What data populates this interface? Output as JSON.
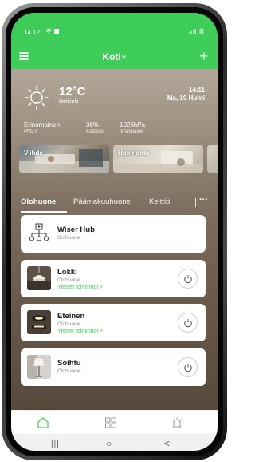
{
  "status_bar": {
    "time": "14.12",
    "left_icons": "᭻ ■",
    "right_icons": "⧂.❙l ▮"
  },
  "header": {
    "title": "Koti",
    "title_chevron": "˅",
    "add_label": "+"
  },
  "weather": {
    "temperature": "12°C",
    "city": "Helsinki",
    "time": "14:11",
    "date": "Ma, 19 Huhti",
    "metrics": [
      {
        "value": "Erinomainen",
        "label": "PM2.5"
      },
      {
        "value": "38%",
        "label": "Kosteus"
      },
      {
        "value": "1026hPa",
        "label": "Ilmanpaine"
      }
    ]
  },
  "scenes": [
    {
      "label": "Viihde"
    },
    {
      "label": "Huomenta"
    }
  ],
  "rooms": {
    "tabs": [
      "Olohuone",
      "Päämakuuhuone",
      "Keittiö"
    ],
    "active": "Olohuone",
    "more_label": "···"
  },
  "devices": [
    {
      "name": "Wiser Hub",
      "room": "Olohuone",
      "actions": "",
      "icon": "hub-icon"
    },
    {
      "name": "Lokki",
      "room": "Olohuone",
      "actions": "Yleiset toiminnot ˅",
      "icon": "pendant-lamp"
    },
    {
      "name": "Eteinen",
      "room": "Olohuone",
      "actions": "Yleiset toiminnot ˅",
      "icon": "ceiling-light"
    },
    {
      "name": "Soihtu",
      "room": "Olohuone",
      "actions": "",
      "icon": "floor-lamp"
    }
  ],
  "bottom_nav": [
    "home-icon",
    "devices-grid-icon",
    "alarm-icon"
  ],
  "system_nav": {
    "recents": "|||",
    "home": "○",
    "back": "<"
  },
  "colors": {
    "accent": "#3dcd58",
    "card": "#ffffff",
    "text": "#222222",
    "muted": "#8c8c8c"
  }
}
